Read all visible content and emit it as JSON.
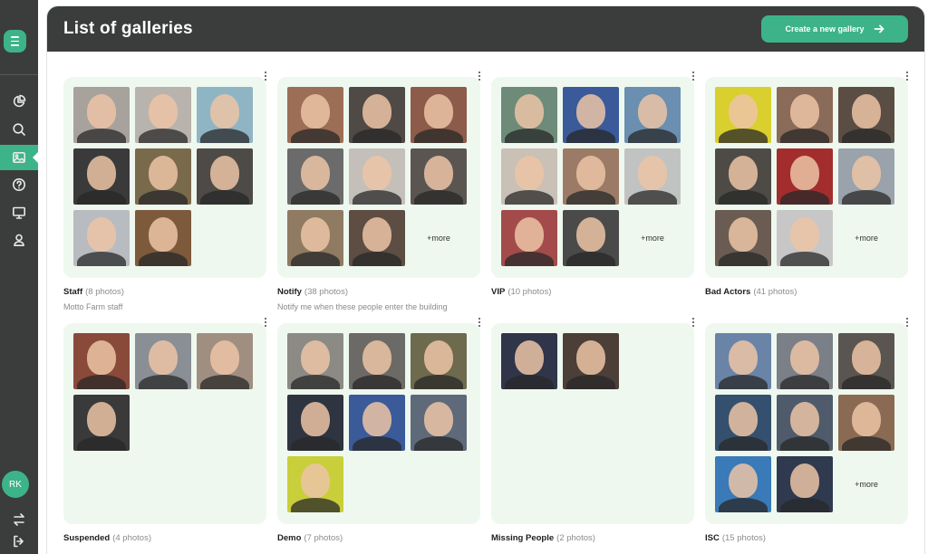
{
  "header": {
    "title": "List of galleries",
    "create_label": "Create a new gallery"
  },
  "sidebar": {
    "avatar_initials": "RK",
    "items": [
      {
        "icon": "pie-chart-icon"
      },
      {
        "icon": "search-icon"
      },
      {
        "icon": "image-icon",
        "active": true
      },
      {
        "icon": "help-icon"
      },
      {
        "icon": "monitor-icon"
      },
      {
        "icon": "user-icon"
      }
    ],
    "bottom_icons": [
      "swap-icon",
      "logout-icon"
    ]
  },
  "colors": {
    "accent": "#3db38a",
    "dark": "#3b3d3c",
    "card_bg": "#eef8ef"
  },
  "more_label": "+more",
  "galleries": [
    {
      "name": "Staff",
      "count": "(8 photos)",
      "description": "Motto Farm staff",
      "thumbs": [
        "#a8a29c",
        "#b9b3ad",
        "#8fb5c4",
        "#3a3a3a",
        "#7a6a4c",
        "#4d4a47",
        "#b8bcc0",
        "#7d5a3c"
      ],
      "more": false
    },
    {
      "name": "Notify",
      "count": "(38 photos)",
      "description": "Notify me when these people enter the building",
      "thumbs": [
        "#9c6e55",
        "#4f4a45",
        "#8c5b4a",
        "#6a6b6a",
        "#c4bfb8",
        "#5a5550",
        "#8f7a62",
        "#5d4d42"
      ],
      "more": true
    },
    {
      "name": "VIP",
      "count": "(10 photos)",
      "description": "",
      "thumbs": [
        "#6e8b7a",
        "#3a5a99",
        "#6a8fb0",
        "#c9c0b6",
        "#9c7b66",
        "#c1c3c2",
        "#a34b4b",
        "#4a4a4a"
      ],
      "more": true
    },
    {
      "name": "Bad Actors",
      "count": "(41 photos)",
      "description": "",
      "thumbs": [
        "#d9cf2e",
        "#8a6a58",
        "#5a4d44",
        "#4e4b47",
        "#a32d2d",
        "#9aa2ab",
        "#6a5c52",
        "#c7c7c7"
      ],
      "more": true
    },
    {
      "name": "Suspended",
      "count": "(4 photos)",
      "description": "",
      "thumbs": [
        "#8a4a3a",
        "#8a8f95",
        "#a08f80",
        "#3a3a3a"
      ],
      "more": false
    },
    {
      "name": "Demo",
      "count": "(7 photos)",
      "description": "",
      "thumbs": [
        "#8c8a84",
        "#6c6a66",
        "#6e6a4e",
        "#2e3440",
        "#3a5a99",
        "#5e6a7a",
        "#c8cf3a"
      ],
      "more": false
    },
    {
      "name": "Missing People",
      "count": "(2 photos)",
      "description": "",
      "thumbs": [
        "#30354a",
        "#4c3f38"
      ],
      "more": false
    },
    {
      "name": "ISC",
      "count": "(15 photos)",
      "description": "",
      "thumbs": [
        "#6a84a8",
        "#7a7f88",
        "#5a5550",
        "#35506e",
        "#4f5b6a",
        "#8a6a52",
        "#3a7ab8",
        "#2f3a4f"
      ],
      "more": true
    }
  ]
}
